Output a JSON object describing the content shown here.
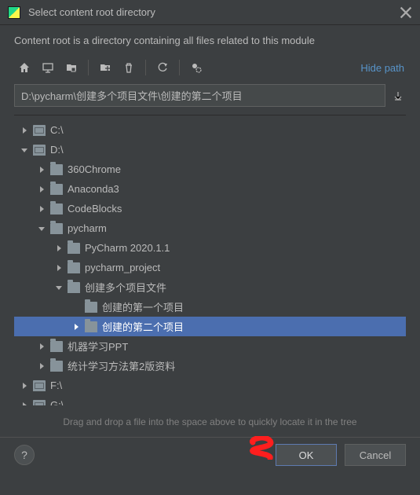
{
  "window": {
    "title": "Select content root directory",
    "subtitle": "Content root is a directory containing all files related to this module"
  },
  "toolbar": {
    "hide_path_label": "Hide path"
  },
  "path": {
    "value": "D:\\pycharm\\创建多个项目文件\\创建的第二个项目"
  },
  "tree": [
    {
      "label": "C:\\",
      "depth": 0,
      "type": "drive",
      "expanded": false,
      "selected": false,
      "hasChildren": true
    },
    {
      "label": "D:\\",
      "depth": 0,
      "type": "drive",
      "expanded": true,
      "selected": false,
      "hasChildren": true
    },
    {
      "label": "360Chrome",
      "depth": 1,
      "type": "folder",
      "expanded": false,
      "selected": false,
      "hasChildren": true
    },
    {
      "label": "Anaconda3",
      "depth": 1,
      "type": "folder",
      "expanded": false,
      "selected": false,
      "hasChildren": true
    },
    {
      "label": "CodeBlocks",
      "depth": 1,
      "type": "folder",
      "expanded": false,
      "selected": false,
      "hasChildren": true
    },
    {
      "label": "pycharm",
      "depth": 1,
      "type": "folder",
      "expanded": true,
      "selected": false,
      "hasChildren": true
    },
    {
      "label": "PyCharm 2020.1.1",
      "depth": 2,
      "type": "folder",
      "expanded": false,
      "selected": false,
      "hasChildren": true
    },
    {
      "label": "pycharm_project",
      "depth": 2,
      "type": "folder",
      "expanded": false,
      "selected": false,
      "hasChildren": true
    },
    {
      "label": "创建多个项目文件",
      "depth": 2,
      "type": "folder",
      "expanded": true,
      "selected": false,
      "hasChildren": true
    },
    {
      "label": "创建的第一个项目",
      "depth": 3,
      "type": "folder",
      "expanded": false,
      "selected": false,
      "hasChildren": false
    },
    {
      "label": "创建的第二个项目",
      "depth": 3,
      "type": "folder",
      "expanded": false,
      "selected": true,
      "hasChildren": true
    },
    {
      "label": "机器学习PPT",
      "depth": 1,
      "type": "folder",
      "expanded": false,
      "selected": false,
      "hasChildren": true
    },
    {
      "label": "统计学习方法第2版资料",
      "depth": 1,
      "type": "folder",
      "expanded": false,
      "selected": false,
      "hasChildren": true
    },
    {
      "label": "F:\\",
      "depth": 0,
      "type": "drive",
      "expanded": false,
      "selected": false,
      "hasChildren": true
    },
    {
      "label": "G:\\",
      "depth": 0,
      "type": "drive",
      "expanded": false,
      "selected": false,
      "hasChildren": true
    }
  ],
  "hint": "Drag and drop a file into the space above to quickly locate it in the tree",
  "buttons": {
    "help": "?",
    "ok": "OK",
    "cancel": "Cancel"
  }
}
